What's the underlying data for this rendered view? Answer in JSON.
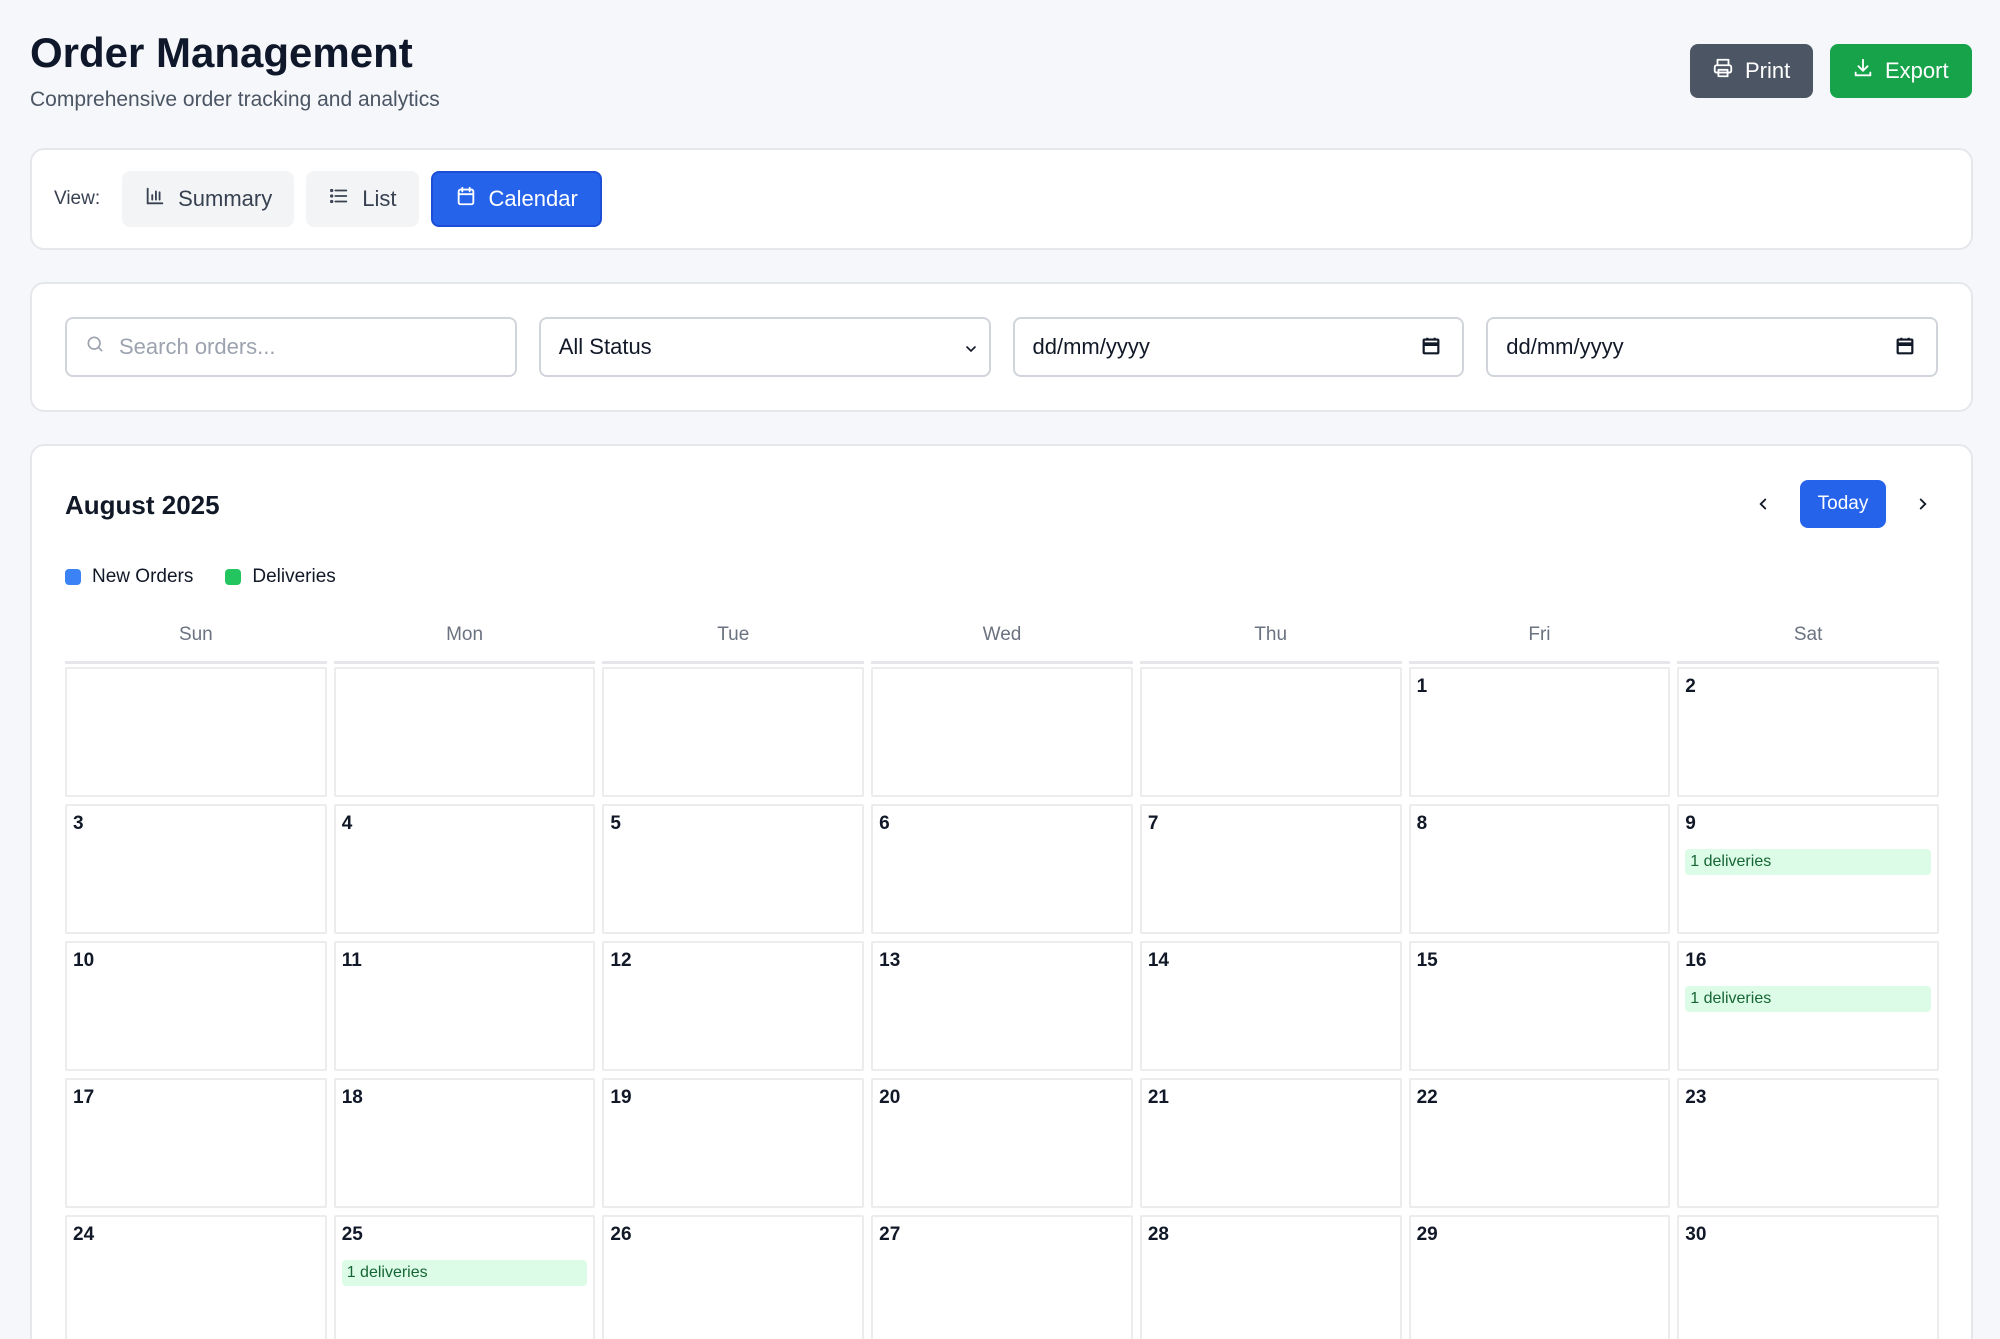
{
  "header": {
    "title": "Order Management",
    "subtitle": "Comprehensive order tracking and analytics",
    "print_label": "Print",
    "export_label": "Export",
    "print_color": "#4b5563",
    "export_color": "#16a34a"
  },
  "view": {
    "label": "View:",
    "options": [
      {
        "label": "Summary",
        "icon": "bar-chart-icon",
        "active": false
      },
      {
        "label": "List",
        "icon": "list-icon",
        "active": false
      },
      {
        "label": "Calendar",
        "icon": "calendar-icon",
        "active": true
      }
    ]
  },
  "filters": {
    "search_placeholder": "Search orders...",
    "status_value": "All Status",
    "date_from": "dd/mm/yyyy",
    "date_to": "dd/mm/yyyy"
  },
  "calendar": {
    "month": "August 2025",
    "today_label": "Today",
    "legend": [
      {
        "label": "New Orders",
        "color": "#3b82f6"
      },
      {
        "label": "Deliveries",
        "color": "#22c55e"
      }
    ],
    "weekdays": [
      "Sun",
      "Mon",
      "Tue",
      "Wed",
      "Thu",
      "Fri",
      "Sat"
    ],
    "cells": [
      {
        "day": ""
      },
      {
        "day": ""
      },
      {
        "day": ""
      },
      {
        "day": ""
      },
      {
        "day": ""
      },
      {
        "day": "1"
      },
      {
        "day": "2"
      },
      {
        "day": "3"
      },
      {
        "day": "4"
      },
      {
        "day": "5"
      },
      {
        "day": "6"
      },
      {
        "day": "7"
      },
      {
        "day": "8"
      },
      {
        "day": "9",
        "event": "1 deliveries"
      },
      {
        "day": "10"
      },
      {
        "day": "11"
      },
      {
        "day": "12"
      },
      {
        "day": "13"
      },
      {
        "day": "14"
      },
      {
        "day": "15"
      },
      {
        "day": "16",
        "event": "1 deliveries"
      },
      {
        "day": "17"
      },
      {
        "day": "18"
      },
      {
        "day": "19"
      },
      {
        "day": "20"
      },
      {
        "day": "21"
      },
      {
        "day": "22"
      },
      {
        "day": "23"
      },
      {
        "day": "24"
      },
      {
        "day": "25",
        "event": "1 deliveries"
      },
      {
        "day": "26"
      },
      {
        "day": "27"
      },
      {
        "day": "28"
      },
      {
        "day": "29"
      },
      {
        "day": "30"
      }
    ]
  }
}
